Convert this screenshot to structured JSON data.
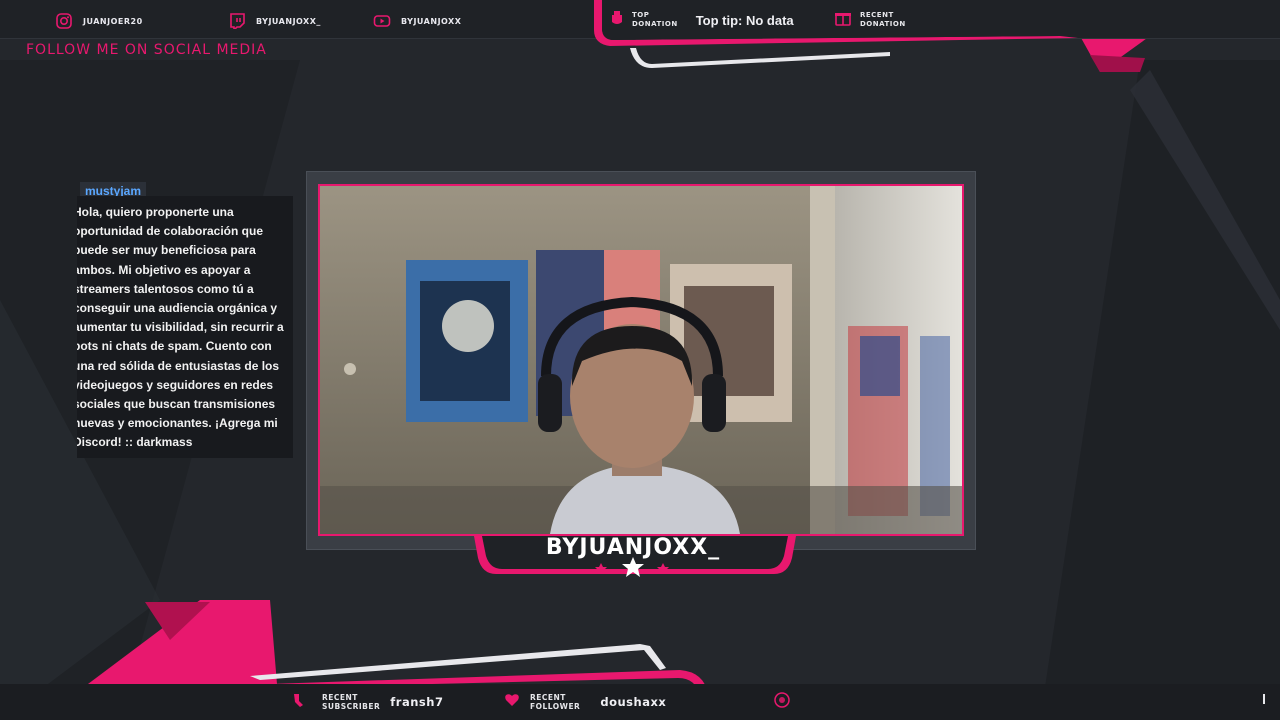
{
  "social": {
    "title": "FOLLOW ME ON SOCIAL MEDIA",
    "accounts": [
      {
        "platform_icon": "instagram-icon",
        "handle": "JUANJOER20"
      },
      {
        "platform_icon": "twitch-icon",
        "handle": "BYJUANJOXX_"
      },
      {
        "platform_icon": "youtube-icon",
        "handle": "BYJUANJOXX"
      }
    ]
  },
  "donations": {
    "top_label_1": "TOP",
    "top_label_2": "DONATION",
    "top_value": "Top tip: No data",
    "recent_label_1": "RECENT",
    "recent_label_2": "DONATION"
  },
  "chat": {
    "username": "mustyjam",
    "message": "Hola, quiero proponerte una oportunidad de colaboración que puede ser muy beneficiosa para ambos. Mi objetivo es apoyar a streamers talentosos como tú a conseguir una audiencia orgánica y aumentar tu visibilidad, sin recurrir a bots ni chats de spam. Cuento con una red sólida de entusiastas de los videojuegos y seguidores en redes sociales que buscan transmisiones nuevas y emocionantes. ¡Agrega mi Discord! :: darkmass"
  },
  "stream": {
    "channel_name": "BYJUANJOXX_"
  },
  "bottom": {
    "subscriber_label_1": "RECENT",
    "subscriber_label_2": "SUBSCRIBER",
    "subscriber_value": "fransh7",
    "follower_label_1": "RECENT",
    "follower_label_2": "FOLLOWER",
    "follower_value": "doushaxx"
  },
  "colors": {
    "accent": "#e8186e",
    "background": "#24272c",
    "chat_username": "#5aa7ff"
  }
}
